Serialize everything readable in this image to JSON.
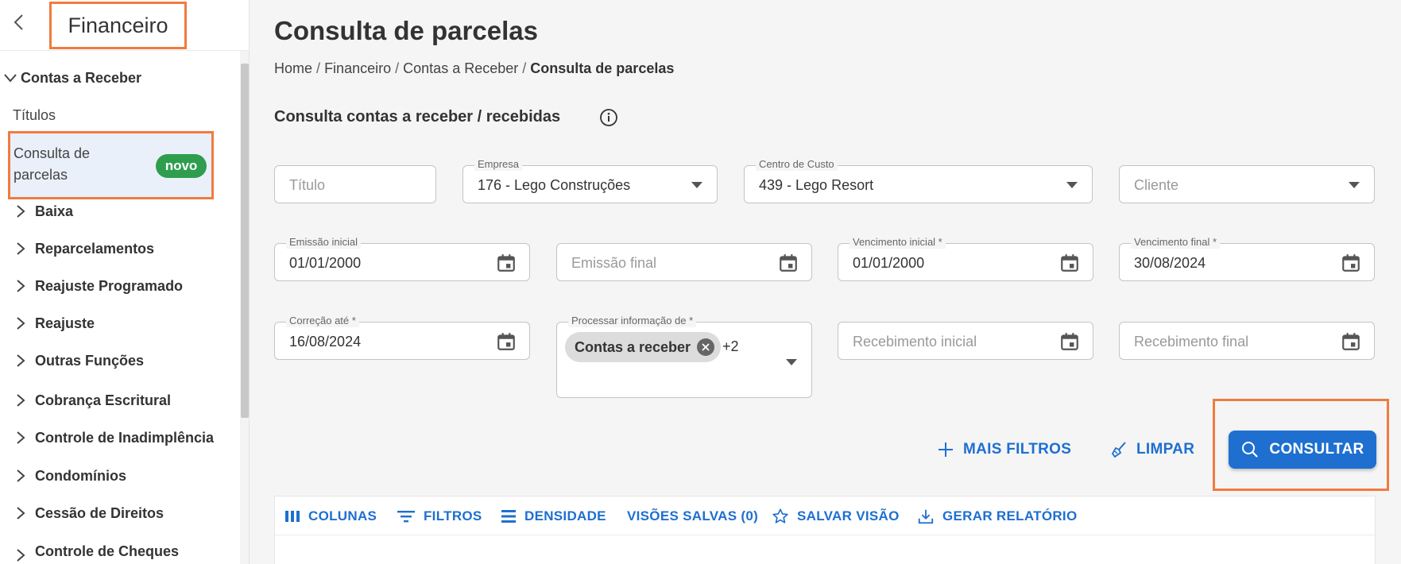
{
  "sidebar": {
    "title": "Financeiro",
    "group": "Contas a Receber",
    "links": [
      "Títulos"
    ],
    "active_item": {
      "label": "Consulta de parcelas",
      "badge": "novo"
    },
    "items": [
      "Baixa",
      "Reparcelamentos",
      "Reajuste Programado",
      "Reajuste",
      "Outras Funções",
      "Cobrança Escritural",
      "Controle de Inadimplência",
      "Condomínios",
      "Cessão de Direitos",
      "Controle de Cheques"
    ]
  },
  "header": {
    "title": "Consulta de parcelas",
    "breadcrumb": [
      "Home",
      "Financeiro",
      "Contas a Receber",
      "Consulta de parcelas"
    ],
    "separator": "/"
  },
  "section": {
    "title": "Consulta contas a receber / recebidas"
  },
  "form": {
    "titulo": {
      "placeholder": "Título"
    },
    "empresa": {
      "label": "Empresa",
      "value": "176 - Lego Construções"
    },
    "centro_custo": {
      "label": "Centro de Custo",
      "value": "439 - Lego Resort"
    },
    "cliente": {
      "placeholder": "Cliente"
    },
    "emissao_inicial": {
      "label": "Emissão inicial",
      "value": "01/01/2000"
    },
    "emissao_final": {
      "placeholder": "Emissão final"
    },
    "vencimento_inicial": {
      "label": "Vencimento inicial *",
      "value": "01/01/2000"
    },
    "vencimento_final": {
      "label": "Vencimento final *",
      "value": "30/08/2024"
    },
    "correcao_ate": {
      "label": "Correção até *",
      "value": "16/08/2024"
    },
    "processar": {
      "label": "Processar informação de *",
      "chip": "Contas a receber",
      "more": "+2"
    },
    "recebimento_inicial": {
      "placeholder": "Recebimento inicial"
    },
    "recebimento_final": {
      "placeholder": "Recebimento final"
    }
  },
  "actions": {
    "mais_filtros": "MAIS FILTROS",
    "limpar": "LIMPAR",
    "consultar": "CONSULTAR"
  },
  "toolbar": {
    "colunas": "COLUNAS",
    "filtros": "FILTROS",
    "densidade": "DENSIDADE",
    "visoes_salvas": "VISÕES SALVAS (0)",
    "salvar_visao": "SALVAR VISÃO",
    "gerar_relatorio": "GERAR RELATÓRIO"
  },
  "colors": {
    "accent": "#1e6fd0",
    "highlight_frame": "#f07b3f",
    "badge": "#2e9e4e",
    "active_bg": "#e9f0fa"
  }
}
